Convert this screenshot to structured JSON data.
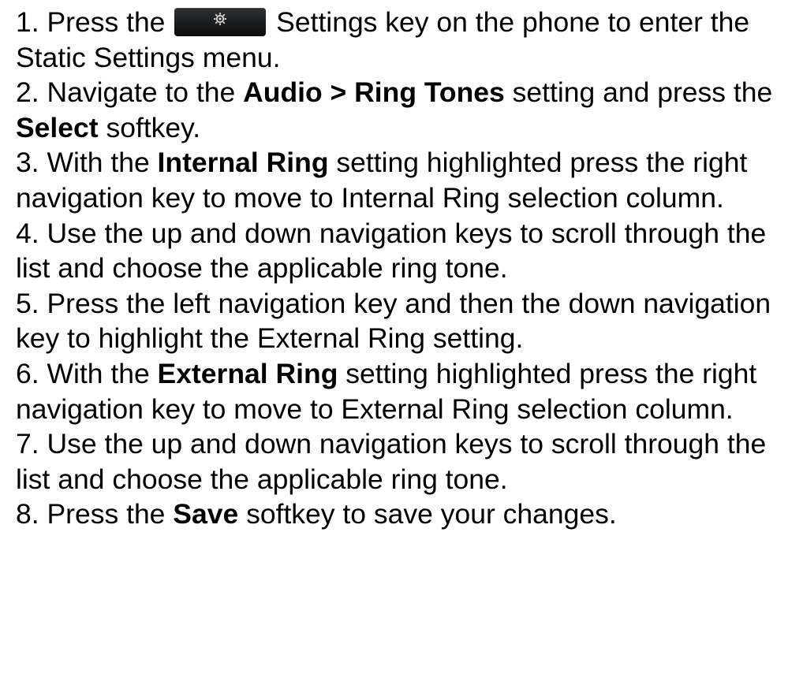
{
  "steps": [
    {
      "s1_before": "1. Press the ",
      "s1_after": " Settings key on the phone to enter the Static Settings menu."
    },
    {
      "a": "2. Navigate to the ",
      "b": "Audio > Ring Tones",
      "c": " setting and press the ",
      "d": "Select",
      "e": " softkey."
    },
    {
      "a": "3. With the ",
      "b": "Internal Ring",
      "c": " setting highlighted press the right navigation key to move to Internal Ring selection column."
    },
    {
      "a": "4. Use the up and down navigation keys to scroll through the list and choose the applicable ring tone."
    },
    {
      "a": "5. Press the left navigation key and then the down navigation key to highlight the External Ring setting."
    },
    {
      "a": "6. With the ",
      "b": "External Ring",
      "c": " setting highlighted press the right navigation key to move to External Ring selection column."
    },
    {
      "a": "7. Use the up and down navigation keys to scroll through the list and choose the applicable ring tone."
    },
    {
      "a": "8. Press the ",
      "b": "Save",
      "c": " softkey to save your changes."
    }
  ],
  "icons": {
    "settings_key": "gear-icon"
  }
}
